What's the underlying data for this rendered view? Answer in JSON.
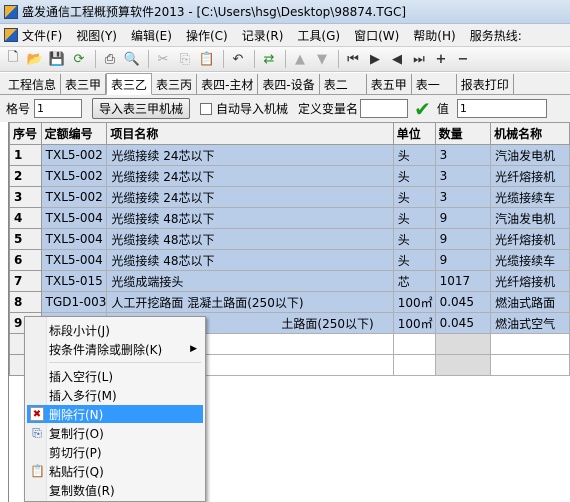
{
  "window": {
    "title": "盛发通信工程概预算软件2013 - [C:\\Users\\hsg\\Desktop\\98874.TGC]"
  },
  "menu": [
    {
      "label": "文件(F)"
    },
    {
      "label": "视图(Y)"
    },
    {
      "label": "编辑(E)"
    },
    {
      "label": "操作(C)"
    },
    {
      "label": "记录(R)"
    },
    {
      "label": "工具(G)"
    },
    {
      "label": "窗口(W)"
    },
    {
      "label": "帮助(H)"
    },
    {
      "label": "服务热线:"
    }
  ],
  "tabs": [
    {
      "label": "工程信息"
    },
    {
      "label": "表三甲"
    },
    {
      "label": "表三乙"
    },
    {
      "label": "表三丙"
    },
    {
      "label": "表四-主材"
    },
    {
      "label": "表四-设备"
    },
    {
      "label": "表二"
    },
    {
      "label": "表五甲"
    },
    {
      "label": "表一"
    },
    {
      "label": "报表打印"
    }
  ],
  "active_tab": "表三乙",
  "options": {
    "format_label": "格号",
    "format_value": "1",
    "import_button": "导入表三甲机械",
    "auto_import_label": "自动导入机械",
    "define_var_label": "定义变量名",
    "define_var_value": "",
    "value_label": "值",
    "value_input": "1"
  },
  "table": {
    "headers": [
      "序号",
      "定额编号",
      "项目名称",
      "单位",
      "数量",
      "机械名称"
    ],
    "rows": [
      {
        "num": "1",
        "code": "TXL5-002",
        "name": "光缆接续 24芯以下",
        "unit": "头",
        "qty": "3",
        "machine": "汽油发电机"
      },
      {
        "num": "2",
        "code": "TXL5-002",
        "name": "光缆接续 24芯以下",
        "unit": "头",
        "qty": "3",
        "machine": "光纤熔接机"
      },
      {
        "num": "3",
        "code": "TXL5-002",
        "name": "光缆接续 24芯以下",
        "unit": "头",
        "qty": "3",
        "machine": "光缆接续车"
      },
      {
        "num": "4",
        "code": "TXL5-004",
        "name": "光缆接续 48芯以下",
        "unit": "头",
        "qty": "9",
        "machine": "汽油发电机"
      },
      {
        "num": "5",
        "code": "TXL5-004",
        "name": "光缆接续 48芯以下",
        "unit": "头",
        "qty": "9",
        "machine": "光纤熔接机"
      },
      {
        "num": "6",
        "code": "TXL5-004",
        "name": "光缆接续 48芯以下",
        "unit": "头",
        "qty": "9",
        "machine": "光缆接续车"
      },
      {
        "num": "7",
        "code": "TXL5-015",
        "name": "光缆成端接头",
        "unit": "芯",
        "qty": "1017",
        "machine": "光纤熔接机"
      },
      {
        "num": "8",
        "code": "TGD1-003",
        "name": "人工开挖路面 混凝土路面(250以下)",
        "unit": "100㎡",
        "qty": "0.045",
        "machine": "燃油式路面"
      },
      {
        "num": "9",
        "code": "",
        "name": "土路面(250以下)",
        "unit": "100㎡",
        "qty": "0.045",
        "machine": "燃油式空气"
      }
    ]
  },
  "context_menu": [
    {
      "label": "标段小计(J)"
    },
    {
      "label": "按条件清除或删除(K)"
    },
    {
      "label": "插入空行(L)"
    },
    {
      "label": "插入多行(M)"
    },
    {
      "label": "删除行(N)"
    },
    {
      "label": "复制行(O)"
    },
    {
      "label": "剪切行(P)"
    },
    {
      "label": "粘贴行(Q)"
    },
    {
      "label": "复制数值(R)"
    }
  ],
  "colors": {
    "selection": "#b9cde9",
    "menu_highlight": "#3399ff"
  }
}
